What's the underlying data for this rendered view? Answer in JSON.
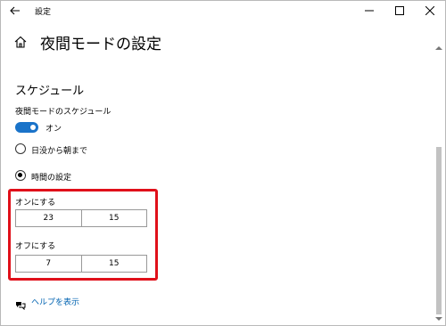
{
  "window": {
    "title": "設定",
    "icons": {
      "back": "back-arrow-icon",
      "minimize": "minimize-icon",
      "maximize": "maximize-icon",
      "close": "close-icon"
    }
  },
  "header": {
    "home_icon": "home-icon",
    "title": "夜間モードの設定"
  },
  "schedule": {
    "section_title": "スケジュール",
    "label": "夜間モードのスケジュール",
    "toggle_text": "オン",
    "toggle_on": true,
    "options": [
      {
        "label": "日没から朝まで",
        "selected": false
      },
      {
        "label": "時間の設定",
        "selected": true
      }
    ],
    "on_time": {
      "label": "オンにする",
      "hour": "23",
      "minute": "15"
    },
    "off_time": {
      "label": "オフにする",
      "hour": "7",
      "minute": "15"
    }
  },
  "help": {
    "icon": "help-chat-icon",
    "label": "ヘルプを表示"
  },
  "colors": {
    "accent": "#1a73c9",
    "highlight": "#e0101a",
    "link": "#0063b1"
  }
}
